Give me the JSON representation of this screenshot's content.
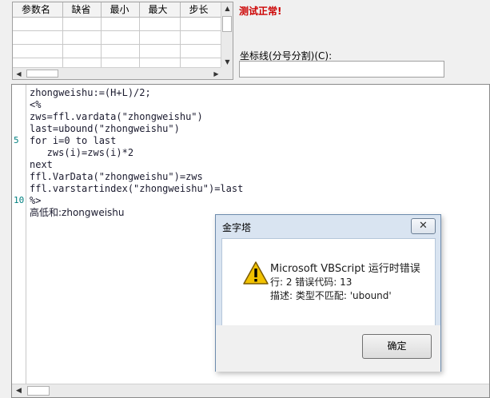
{
  "param_table": {
    "columns": [
      "参数名",
      "缺省",
      "最小",
      "最大",
      "步长"
    ],
    "rows": [
      [
        "",
        "",
        "",
        "",
        ""
      ],
      [
        "",
        "",
        "",
        "",
        ""
      ],
      [
        "",
        "",
        "",
        "",
        ""
      ],
      [
        "",
        "",
        "",
        "",
        ""
      ]
    ]
  },
  "status": {
    "text": "测试正常!",
    "color": "#cc0000"
  },
  "axis_field": {
    "label": "坐标线(分号分割)(C):",
    "value": ""
  },
  "editor": {
    "lines": [
      "zhongweishu:=(H+L)/2;",
      "<%",
      "zws=ffl.vardata(\"zhongweishu\")",
      "last=ubound(\"zhongweishu\")",
      "for i=0 to last",
      "   zws(i)=zws(i)*2",
      "next",
      "ffl.VarData(\"zhongweishu\")=zws",
      "ffl.varstartindex(\"zhongweishu\")=last",
      "%>",
      "高低和:zhongweishu"
    ],
    "line_numbers": [
      {
        "n": "5",
        "line": 5
      },
      {
        "n": "10",
        "line": 10
      }
    ],
    "line_number_color": "#008080"
  },
  "dialog": {
    "title": "金字塔",
    "close_glyph": "✕",
    "message_title": "Microsoft VBScript 运行时错误",
    "message_line2": "行: 2  错误代码: 13",
    "message_line3": "描述: 类型不匹配: 'ubound'",
    "ok_label": "确定",
    "icon": "warning-icon"
  }
}
